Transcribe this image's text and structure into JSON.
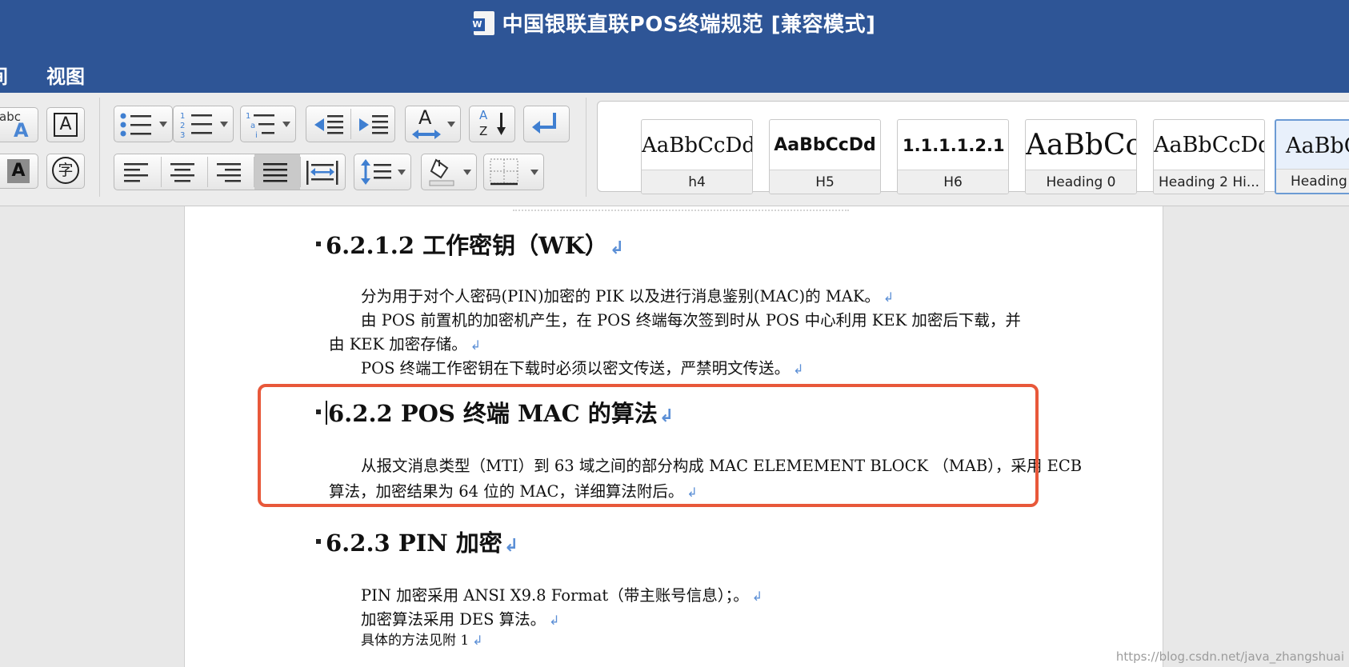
{
  "window": {
    "title": "中国银联直联POS终端规范 [兼容模式]"
  },
  "ribbon_tabs": [
    {
      "label": "间"
    },
    {
      "label": "视图"
    }
  ],
  "toolbar": {
    "font_letters_label": "abc",
    "char_box_label": "A",
    "char_shade_label": "A",
    "enclose_char_label": "字",
    "sort_label_a": "A",
    "sort_label_z": "Z",
    "change_case_label": "A"
  },
  "styles": [
    {
      "preview": "AaBbCcDd",
      "name": "h4"
    },
    {
      "preview": "AaBbCcDd",
      "name": "H5"
    },
    {
      "preview": "1.1.1.1.2.1",
      "name": "H6"
    },
    {
      "preview": "AaBbCc",
      "name": "Heading 0"
    },
    {
      "preview": "AaBbCcDd",
      "name": "Heading 2 Hi..."
    },
    {
      "preview": "AaBbC",
      "name": "Heading"
    }
  ],
  "document": {
    "h_6212": "6.2.1.2 工作密钥（WK）",
    "p_6212_1": "分为用于对个人密码(PIN)加密的 PIK 以及进行消息鉴别(MAC)的 MAK。",
    "p_6212_2": "由 POS 前置机的加密机产生，在 POS 终端每次签到时从 POS 中心利用 KEK 加密后下载，并",
    "p_6212_3": "由 KEK 加密存储。",
    "p_6212_4": "POS 终端工作密钥在下载时必须以密文传送，严禁明文传送。",
    "h_622": "6.2.2 POS 终端 MAC 的算法",
    "p_622_1": "从报文消息类型（MTI）到 63 域之间的部分构成 MAC ELEMEMENT BLOCK （MAB），采用 ECB",
    "p_622_2": "算法，加密结果为 64 位的 MAC，详细算法附后。",
    "h_623": "6.2.3 PIN 加密",
    "p_623_1": "PIN 加密采用 ANSI X9.8 Format（带主账号信息）；。",
    "p_623_2": "加密算法采用 DES 算法。",
    "p_623_3": "具体的方法见附 1",
    "para_mark": "↲"
  },
  "watermark": "https://blog.csdn.net/java_zhangshuai",
  "colors": {
    "title_bar": "#2e5596",
    "highlight_border": "#e8583a",
    "para_mark": "#5b8fd6",
    "style_selected_border": "#6c9bd4"
  }
}
